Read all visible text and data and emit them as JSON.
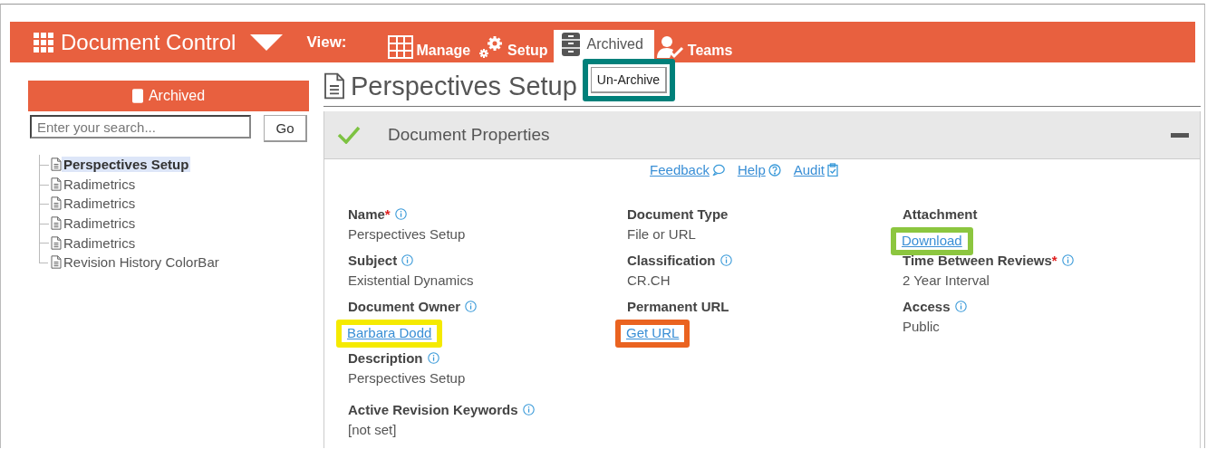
{
  "header": {
    "title": "Document Control",
    "view_label": "View:",
    "tabs": [
      {
        "label": "Manage",
        "selected": false
      },
      {
        "label": "Setup",
        "selected": false
      },
      {
        "label": "Archived",
        "selected": true
      },
      {
        "label": "Teams",
        "selected": false
      }
    ]
  },
  "sidebar": {
    "title": "Archived",
    "search": {
      "placeholder": "Enter your search..."
    },
    "go_button": "Go",
    "tree": [
      {
        "label": "Perspectives Setup",
        "selected": true
      },
      {
        "label": "Radimetrics",
        "selected": false
      },
      {
        "label": "Radimetrics",
        "selected": false
      },
      {
        "label": "Radimetrics",
        "selected": false
      },
      {
        "label": "Radimetrics",
        "selected": false
      },
      {
        "label": "Revision History ColorBar",
        "selected": false
      }
    ]
  },
  "main": {
    "title": "Perspectives Setup",
    "unarchive_button": {
      "label": "Un-Archive",
      "highlight": {
        "color": "#00807a"
      }
    },
    "panel": {
      "title": "Document Properties",
      "links": [
        {
          "label": "Feedback"
        },
        {
          "label": "Help"
        },
        {
          "label": "Audit"
        }
      ],
      "rows": [
        [
          {
            "label": "Name",
            "required_mark": "*",
            "info": true,
            "value": "Perspectives Setup",
            "kind": "text"
          },
          {
            "label": "Document Type",
            "info": false,
            "value": "File or URL",
            "kind": "text"
          },
          {
            "label": "Attachment",
            "info": false,
            "value": "Download",
            "kind": "link",
            "highlight": {
              "color": "#8cc63f"
            }
          }
        ],
        [
          {
            "label": "Subject",
            "info": true,
            "value": "Existential Dynamics",
            "kind": "text"
          },
          {
            "label": "Classification",
            "info": true,
            "value": "CR.CH",
            "kind": "text"
          },
          {
            "label": "Time Between Reviews",
            "required_mark": "*",
            "info": true,
            "value": "2 Year Interval",
            "kind": "text"
          }
        ],
        [
          {
            "label": "Document Owner",
            "info": true,
            "value": "Barbara Dodd",
            "kind": "link",
            "highlight": {
              "color": "#f5ea00"
            }
          },
          {
            "label": "Permanent URL",
            "info": false,
            "value": "Get URL",
            "kind": "link",
            "highlight": {
              "color": "#ea6320"
            }
          },
          {
            "label": "Access",
            "info": true,
            "value": "Public",
            "kind": "text"
          }
        ],
        [
          {
            "label": "Description",
            "info": true,
            "value": "Perspectives Setup",
            "kind": "text"
          }
        ],
        [
          {
            "label": "Active Revision Keywords",
            "info": true,
            "value": "[not set]",
            "kind": "text"
          }
        ]
      ]
    }
  }
}
